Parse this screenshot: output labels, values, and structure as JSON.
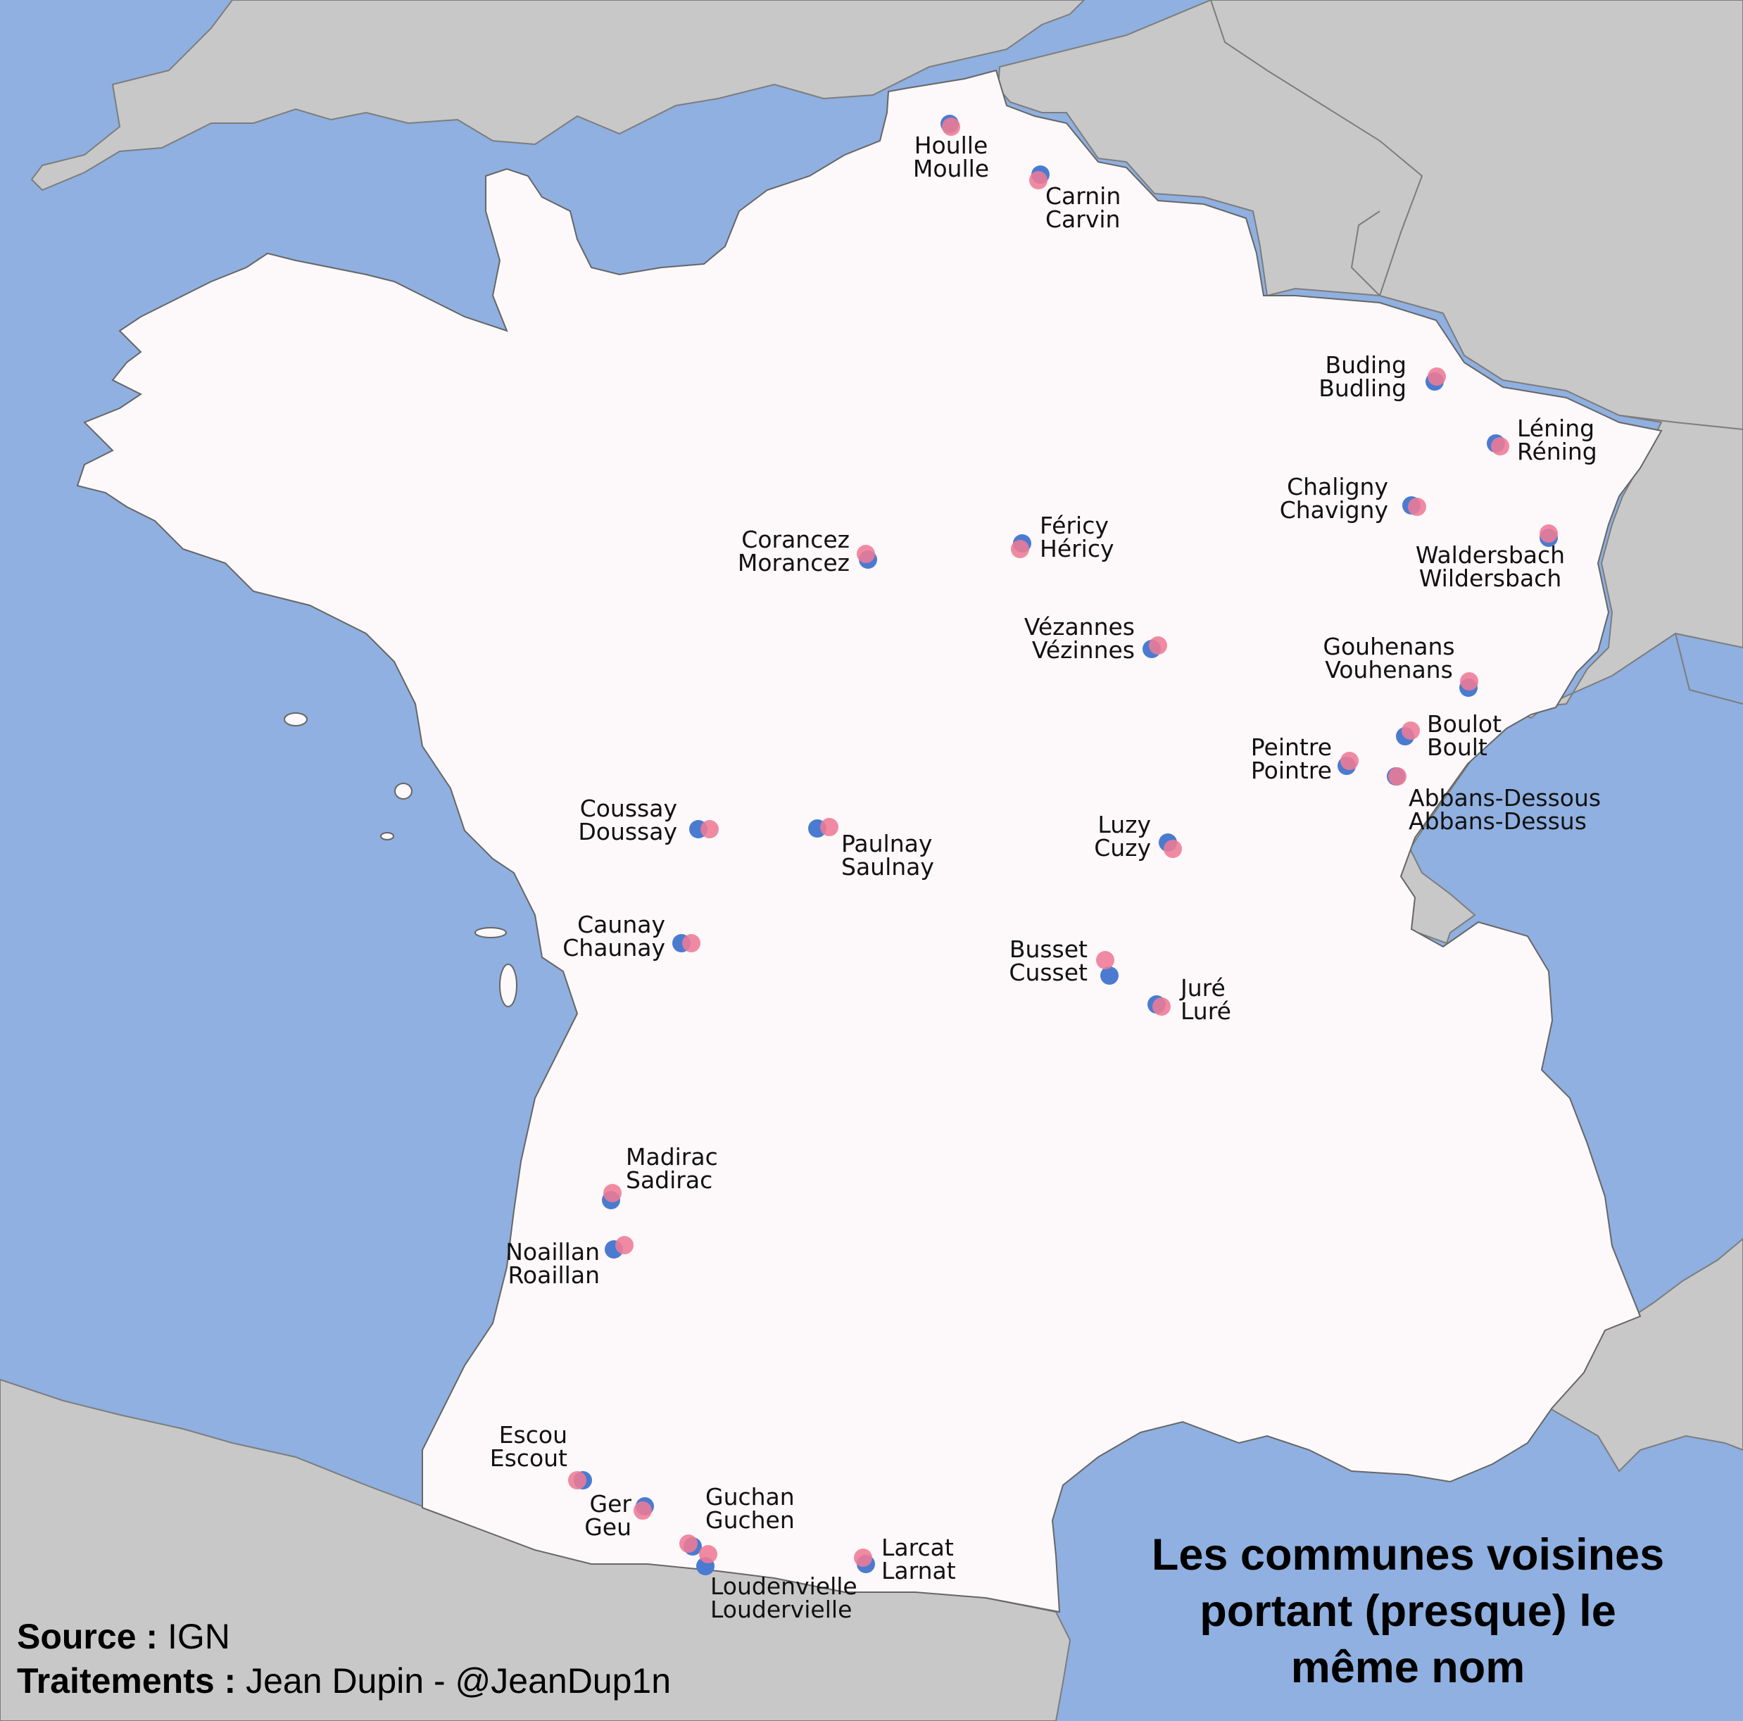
{
  "title_lines": [
    "Les communes voisines",
    "portant (presque) le",
    "même nom"
  ],
  "source": {
    "label": "Source :",
    "value": "IGN"
  },
  "credits": {
    "label": "Traitements :",
    "value": "Jean Dupin - @JeanDup1n"
  },
  "colors": {
    "sea": "#8fb0e0",
    "france": "#fdf8fa",
    "neighbors": "#c8c8c8",
    "dot_blue": "#4a7bd0",
    "dot_pink": "#ee7a95"
  },
  "pairs": [
    {
      "name1": "Houlle",
      "name2": "Moulle",
      "dot1": [
        1349,
        176
      ],
      "dot2": [
        1351,
        180
      ],
      "label": [
        1351,
        218
      ],
      "anchor": "middle"
    },
    {
      "name1": "Carnin",
      "name2": "Carvin",
      "dot1": [
        1478,
        248
      ],
      "dot2": [
        1475,
        256
      ],
      "label": [
        1485,
        290
      ],
      "anchor": "start"
    },
    {
      "name1": "Buding",
      "name2": "Budling",
      "dot1": [
        2038,
        542
      ],
      "dot2": [
        2041,
        535
      ],
      "label": [
        1998,
        530
      ],
      "anchor": "end"
    },
    {
      "name1": "Léning",
      "name2": "Réning",
      "dot1": [
        2125,
        630
      ],
      "dot2": [
        2131,
        634
      ],
      "label": [
        2155,
        620
      ],
      "anchor": "start"
    },
    {
      "name1": "Chaligny",
      "name2": "Chavigny",
      "dot1": [
        2005,
        718
      ],
      "dot2": [
        2013,
        720
      ],
      "label": [
        1972,
        703
      ],
      "anchor": "end"
    },
    {
      "name1": "Waldersbach",
      "name2": "Wildersbach",
      "dot1": [
        2200,
        764
      ],
      "dot2": [
        2200,
        758
      ],
      "label": [
        2117,
        800
      ],
      "anchor": "middle"
    },
    {
      "name1": "Corancez",
      "name2": "Morancez",
      "dot1": [
        1233,
        795
      ],
      "dot2": [
        1230,
        787
      ],
      "label": [
        1207,
        778
      ],
      "anchor": "end"
    },
    {
      "name1": "Féricy",
      "name2": "Héricy",
      "dot1": [
        1452,
        772
      ],
      "dot2": [
        1449,
        780
      ],
      "label": [
        1477,
        758
      ],
      "anchor": "start"
    },
    {
      "name1": "Vézannes",
      "name2": "Vézinnes",
      "dot1": [
        1636,
        922
      ],
      "dot2": [
        1645,
        917
      ],
      "label": [
        1612,
        902
      ],
      "anchor": "end"
    },
    {
      "name1": "Gouhenans",
      "name2": "Vouhenans",
      "dot1": [
        2086,
        977
      ],
      "dot2": [
        2087,
        968
      ],
      "label": [
        1973,
        930
      ],
      "anchor": "middle"
    },
    {
      "name1": "Boulot",
      "name2": "Boult",
      "dot1": [
        1996,
        1046
      ],
      "dot2": [
        2004,
        1038
      ],
      "label": [
        2027,
        1040
      ],
      "anchor": "start"
    },
    {
      "name1": "Peintre",
      "name2": "Pointre",
      "dot1": [
        1913,
        1088
      ],
      "dot2": [
        1917,
        1081
      ],
      "label": [
        1892,
        1073
      ],
      "anchor": "end"
    },
    {
      "name1": "Abbans-Dessous",
      "name2": "Abbans-Dessus",
      "dot1": [
        1983,
        1103
      ],
      "dot2": [
        1985,
        1103
      ],
      "label": [
        2001,
        1145
      ],
      "anchor": "start"
    },
    {
      "name1": "Coussay",
      "name2": "Doussay",
      "dot1": [
        992,
        1178
      ],
      "dot2": [
        1008,
        1178
      ],
      "label": [
        962,
        1160
      ],
      "anchor": "end"
    },
    {
      "name1": "Paulnay",
      "name2": "Saulnay",
      "dot1": [
        1161,
        1177
      ],
      "dot2": [
        1178,
        1175
      ],
      "label": [
        1195,
        1210
      ],
      "anchor": "start"
    },
    {
      "name1": "Luzy",
      "name2": "Cuzy",
      "dot1": [
        1659,
        1197
      ],
      "dot2": [
        1666,
        1206
      ],
      "label": [
        1635,
        1183
      ],
      "anchor": "end"
    },
    {
      "name1": "Caunay",
      "name2": "Chaunay",
      "dot1": [
        968,
        1340
      ],
      "dot2": [
        982,
        1340
      ],
      "label": [
        945,
        1325
      ],
      "anchor": "end"
    },
    {
      "name1": "Busset",
      "name2": "Cusset",
      "dot1": [
        1576,
        1386
      ],
      "dot2": [
        1570,
        1364
      ],
      "label": [
        1545,
        1360
      ],
      "anchor": "end"
    },
    {
      "name1": "Juré",
      "name2": "Luré",
      "dot1": [
        1643,
        1427
      ],
      "dot2": [
        1650,
        1430
      ],
      "label": [
        1677,
        1415
      ],
      "anchor": "start"
    },
    {
      "name1": "Madirac",
      "name2": "Sadirac",
      "dot1": [
        868,
        1705
      ],
      "dot2": [
        870,
        1695
      ],
      "label": [
        889,
        1655
      ],
      "anchor": "start"
    },
    {
      "name1": "Noaillan",
      "name2": "Roaillan",
      "dot1": [
        872,
        1775
      ],
      "dot2": [
        887,
        1769
      ],
      "label": [
        852,
        1790
      ],
      "anchor": "end"
    },
    {
      "name1": "Escou",
      "name2": "Escout",
      "dot1": [
        828,
        2103
      ],
      "dot2": [
        820,
        2103
      ],
      "label": [
        806,
        2050
      ],
      "anchor": "end"
    },
    {
      "name1": "Ger",
      "name2": "Geu",
      "dot1": [
        916,
        2140
      ],
      "dot2": [
        913,
        2146
      ],
      "label": [
        897,
        2148
      ],
      "anchor": "end"
    },
    {
      "name1": "Guchan",
      "name2": "Guchen",
      "dot1": [
        984,
        2197
      ],
      "dot2": [
        978,
        2193
      ],
      "label": [
        1002,
        2138
      ],
      "anchor": "start"
    },
    {
      "name1": "Loudenvielle",
      "name2": "Loudervielle",
      "dot1": [
        1002,
        2225
      ],
      "dot2": [
        1006,
        2208
      ],
      "label": [
        1009,
        2265
      ],
      "anchor": "start"
    },
    {
      "name1": "Larcat",
      "name2": "Larnat",
      "dot1": [
        1230,
        2222
      ],
      "dot2": [
        1226,
        2213
      ],
      "label": [
        1252,
        2210
      ],
      "anchor": "start"
    }
  ]
}
